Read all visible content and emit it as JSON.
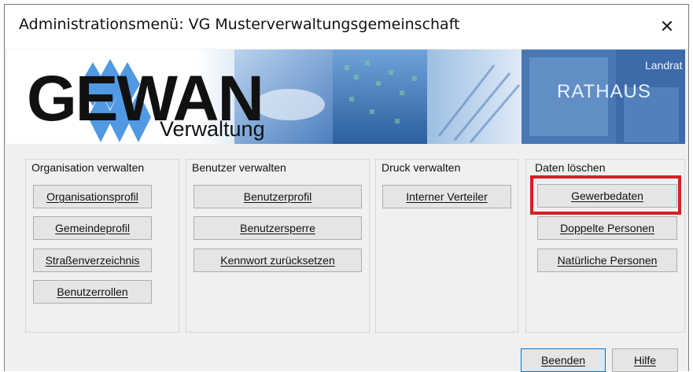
{
  "window": {
    "title": "Administrationsmenü: VG Musterverwaltungsgemeinschaft",
    "close_glyph": "✕"
  },
  "banner": {
    "logo_text": "GEWAN",
    "logo_sub": "Verwaltung",
    "photo_text_1": "RATHAUS",
    "photo_text_2": "Landrat",
    "accent_color": "#3f8fe0"
  },
  "groups": [
    {
      "label": "Organisation verwalten",
      "buttons": [
        "Organisationsprofil",
        "Gemeindeprofil",
        "Straßenverzeichnis",
        "Benutzerrollen"
      ]
    },
    {
      "label": "Benutzer verwalten",
      "buttons": [
        "Benutzerprofil",
        "Benutzersperre",
        "Kennwort zurücksetzen"
      ]
    },
    {
      "label": "Druck verwalten",
      "buttons": [
        "Interner Verteiler"
      ]
    },
    {
      "label": "Daten löschen",
      "buttons": [
        "Gewerbedaten",
        "Doppelte Personen",
        "Natürliche Personen"
      ]
    }
  ],
  "footer": {
    "close_label": "Beenden",
    "help_label": "Hilfe"
  },
  "highlight_color": "#d81f26"
}
